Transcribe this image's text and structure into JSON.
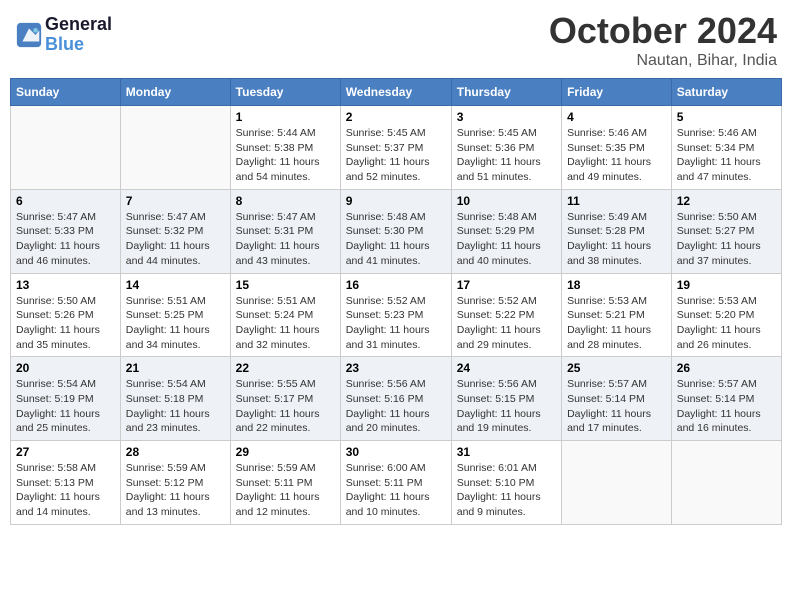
{
  "header": {
    "logo_line1": "General",
    "logo_line2": "Blue",
    "month": "October 2024",
    "location": "Nautan, Bihar, India"
  },
  "weekdays": [
    "Sunday",
    "Monday",
    "Tuesday",
    "Wednesday",
    "Thursday",
    "Friday",
    "Saturday"
  ],
  "weeks": [
    [
      {
        "day": "",
        "info": ""
      },
      {
        "day": "",
        "info": ""
      },
      {
        "day": "1",
        "info": "Sunrise: 5:44 AM\nSunset: 5:38 PM\nDaylight: 11 hours and 54 minutes."
      },
      {
        "day": "2",
        "info": "Sunrise: 5:45 AM\nSunset: 5:37 PM\nDaylight: 11 hours and 52 minutes."
      },
      {
        "day": "3",
        "info": "Sunrise: 5:45 AM\nSunset: 5:36 PM\nDaylight: 11 hours and 51 minutes."
      },
      {
        "day": "4",
        "info": "Sunrise: 5:46 AM\nSunset: 5:35 PM\nDaylight: 11 hours and 49 minutes."
      },
      {
        "day": "5",
        "info": "Sunrise: 5:46 AM\nSunset: 5:34 PM\nDaylight: 11 hours and 47 minutes."
      }
    ],
    [
      {
        "day": "6",
        "info": "Sunrise: 5:47 AM\nSunset: 5:33 PM\nDaylight: 11 hours and 46 minutes."
      },
      {
        "day": "7",
        "info": "Sunrise: 5:47 AM\nSunset: 5:32 PM\nDaylight: 11 hours and 44 minutes."
      },
      {
        "day": "8",
        "info": "Sunrise: 5:47 AM\nSunset: 5:31 PM\nDaylight: 11 hours and 43 minutes."
      },
      {
        "day": "9",
        "info": "Sunrise: 5:48 AM\nSunset: 5:30 PM\nDaylight: 11 hours and 41 minutes."
      },
      {
        "day": "10",
        "info": "Sunrise: 5:48 AM\nSunset: 5:29 PM\nDaylight: 11 hours and 40 minutes."
      },
      {
        "day": "11",
        "info": "Sunrise: 5:49 AM\nSunset: 5:28 PM\nDaylight: 11 hours and 38 minutes."
      },
      {
        "day": "12",
        "info": "Sunrise: 5:50 AM\nSunset: 5:27 PM\nDaylight: 11 hours and 37 minutes."
      }
    ],
    [
      {
        "day": "13",
        "info": "Sunrise: 5:50 AM\nSunset: 5:26 PM\nDaylight: 11 hours and 35 minutes."
      },
      {
        "day": "14",
        "info": "Sunrise: 5:51 AM\nSunset: 5:25 PM\nDaylight: 11 hours and 34 minutes."
      },
      {
        "day": "15",
        "info": "Sunrise: 5:51 AM\nSunset: 5:24 PM\nDaylight: 11 hours and 32 minutes."
      },
      {
        "day": "16",
        "info": "Sunrise: 5:52 AM\nSunset: 5:23 PM\nDaylight: 11 hours and 31 minutes."
      },
      {
        "day": "17",
        "info": "Sunrise: 5:52 AM\nSunset: 5:22 PM\nDaylight: 11 hours and 29 minutes."
      },
      {
        "day": "18",
        "info": "Sunrise: 5:53 AM\nSunset: 5:21 PM\nDaylight: 11 hours and 28 minutes."
      },
      {
        "day": "19",
        "info": "Sunrise: 5:53 AM\nSunset: 5:20 PM\nDaylight: 11 hours and 26 minutes."
      }
    ],
    [
      {
        "day": "20",
        "info": "Sunrise: 5:54 AM\nSunset: 5:19 PM\nDaylight: 11 hours and 25 minutes."
      },
      {
        "day": "21",
        "info": "Sunrise: 5:54 AM\nSunset: 5:18 PM\nDaylight: 11 hours and 23 minutes."
      },
      {
        "day": "22",
        "info": "Sunrise: 5:55 AM\nSunset: 5:17 PM\nDaylight: 11 hours and 22 minutes."
      },
      {
        "day": "23",
        "info": "Sunrise: 5:56 AM\nSunset: 5:16 PM\nDaylight: 11 hours and 20 minutes."
      },
      {
        "day": "24",
        "info": "Sunrise: 5:56 AM\nSunset: 5:15 PM\nDaylight: 11 hours and 19 minutes."
      },
      {
        "day": "25",
        "info": "Sunrise: 5:57 AM\nSunset: 5:14 PM\nDaylight: 11 hours and 17 minutes."
      },
      {
        "day": "26",
        "info": "Sunrise: 5:57 AM\nSunset: 5:14 PM\nDaylight: 11 hours and 16 minutes."
      }
    ],
    [
      {
        "day": "27",
        "info": "Sunrise: 5:58 AM\nSunset: 5:13 PM\nDaylight: 11 hours and 14 minutes."
      },
      {
        "day": "28",
        "info": "Sunrise: 5:59 AM\nSunset: 5:12 PM\nDaylight: 11 hours and 13 minutes."
      },
      {
        "day": "29",
        "info": "Sunrise: 5:59 AM\nSunset: 5:11 PM\nDaylight: 11 hours and 12 minutes."
      },
      {
        "day": "30",
        "info": "Sunrise: 6:00 AM\nSunset: 5:11 PM\nDaylight: 11 hours and 10 minutes."
      },
      {
        "day": "31",
        "info": "Sunrise: 6:01 AM\nSunset: 5:10 PM\nDaylight: 11 hours and 9 minutes."
      },
      {
        "day": "",
        "info": ""
      },
      {
        "day": "",
        "info": ""
      }
    ]
  ]
}
